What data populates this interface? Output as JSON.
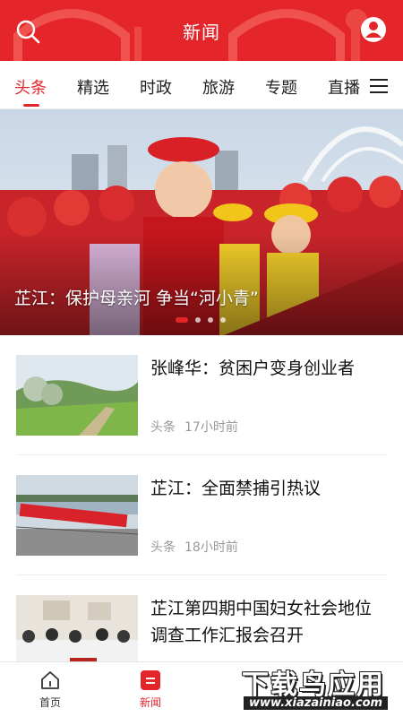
{
  "header": {
    "title": "新闻",
    "search_icon": "search-icon",
    "profile_icon": "user-profile-icon",
    "color": "#e4262b"
  },
  "tabs": [
    {
      "label": "头条",
      "active": true
    },
    {
      "label": "精选",
      "active": false
    },
    {
      "label": "时政",
      "active": false
    },
    {
      "label": "旅游",
      "active": false
    },
    {
      "label": "专题",
      "active": false
    },
    {
      "label": "直播",
      "active": false
    }
  ],
  "tabs_menu_icon": "menu-icon",
  "banner": {
    "caption": "芷江：保护母亲河 争当“河小青”",
    "slide_count": 4,
    "active_slide": 1
  },
  "news": [
    {
      "title": "张峰华：贫困户变身创业者",
      "category": "头条",
      "time": "17小时前"
    },
    {
      "title": "芷江：全面禁捕引热议",
      "category": "头条",
      "time": "18小时前"
    },
    {
      "title": "芷江第四期中国妇女社会地位调查工作汇报会召开",
      "category": "",
      "time": ""
    }
  ],
  "bottom_nav": [
    {
      "label": "首页",
      "icon": "home-icon",
      "active": false
    },
    {
      "label": "新闻",
      "icon": "news-icon",
      "active": true
    }
  ],
  "watermark": {
    "text": "下载鸟应用",
    "url": "www.xiazainiao.com"
  }
}
